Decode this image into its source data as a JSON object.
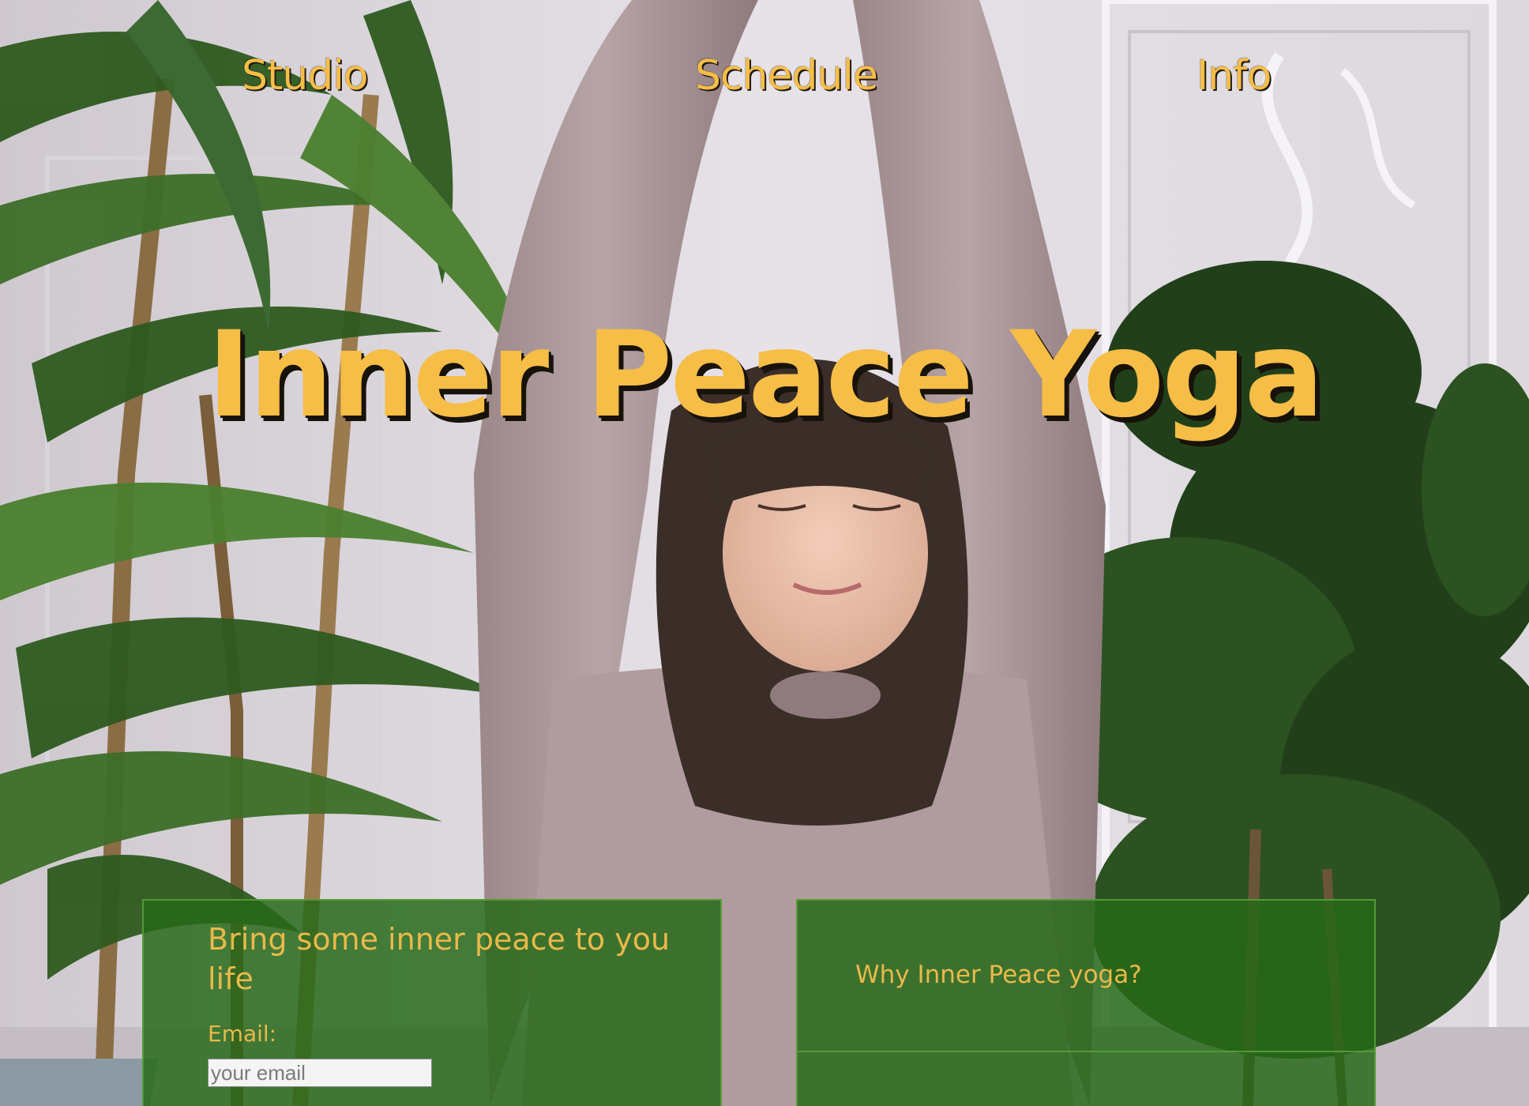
{
  "nav": {
    "studio_label": "Studio",
    "schedule_label": "Schedule",
    "info_label": "Info"
  },
  "hero": {
    "title": "Inner Peace Yoga",
    "image_description": "woman stretching arms overhead, eyes closed, between potted plants"
  },
  "signup": {
    "heading": "Bring some inner peace to you life",
    "email_label": "Email:",
    "email_placeholder": "your email",
    "email_value": ""
  },
  "why": {
    "title": "Why Inner Peace yoga?"
  },
  "colors": {
    "accent_yellow": "#f6bd47",
    "panel_green": "#266918",
    "panel_border": "#56a038"
  }
}
